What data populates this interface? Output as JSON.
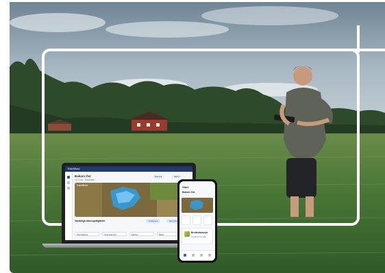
{
  "scene": {
    "description_colors": {
      "sky": "#9fb0bd",
      "field": "#4f7a3a",
      "trees": "#2c4a2a",
      "house": "#9b3b2e",
      "frame": "#ffffff",
      "accent": "#1f56c2"
    }
  },
  "laptop_app": {
    "brand": "FieldView",
    "field_name": "Bakom Öst",
    "field_sub": "12.4 ha · Höstvete",
    "pills": [
      "Planera",
      "Skörd"
    ],
    "section_label": "Varaktiga säsongsåtgärder",
    "buttons": [
      "Analysera",
      "Exportera"
    ],
    "chips": [
      "Skördekarta",
      "Ordinationsfil",
      "Marken",
      "Bilder"
    ],
    "map_label": "Satellitbild"
  },
  "phone_app": {
    "title": "Start",
    "field_name": "Bakom Öst",
    "card_title": "Beståndsanalys",
    "card_sub": "Uppdaterad idag"
  }
}
